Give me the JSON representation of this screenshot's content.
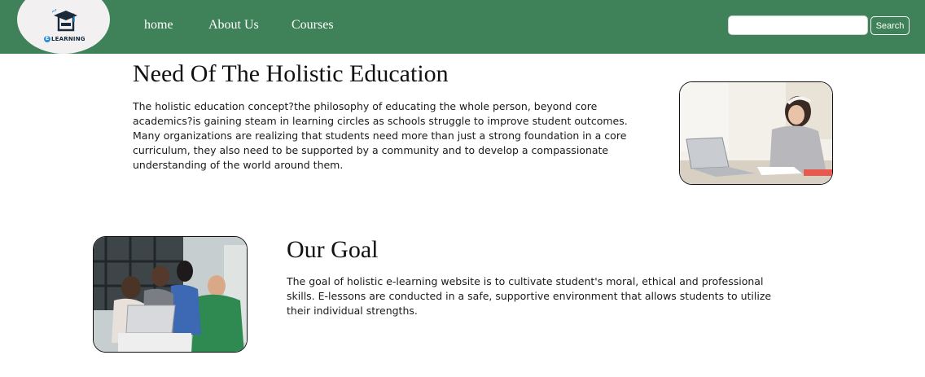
{
  "nav": {
    "logo_text": "LEARNING",
    "logo_badge": "E",
    "links": [
      "home",
      "About Us",
      "Courses"
    ],
    "search": {
      "value": "",
      "placeholder": "",
      "button_label": "Search"
    }
  },
  "section1": {
    "title": "Need Of The Holistic Education",
    "text": "The holistic education concept?the philosophy of educating the whole person, beyond core academics?is gaining steam in learning circles as schools struggle to improve student outcomes. Many organizations are realizing that students need more than just a strong foundation in a core curriculum, they also need to be supported by a community and to develop a compassionate understanding of the world around them."
  },
  "section2": {
    "title": "Our Goal",
    "text": "The goal of holistic e-learning website is to cultivate student's moral, ethical and professional skills. E-lessons are conducted in a safe, supportive environment that allows students to utilize their individual strengths."
  },
  "colors": {
    "nav_background": "#3f8158",
    "logo_background": "#f2f0f0",
    "text": "#1a1a1a"
  },
  "icons": [
    "graduation-cap-icon"
  ]
}
